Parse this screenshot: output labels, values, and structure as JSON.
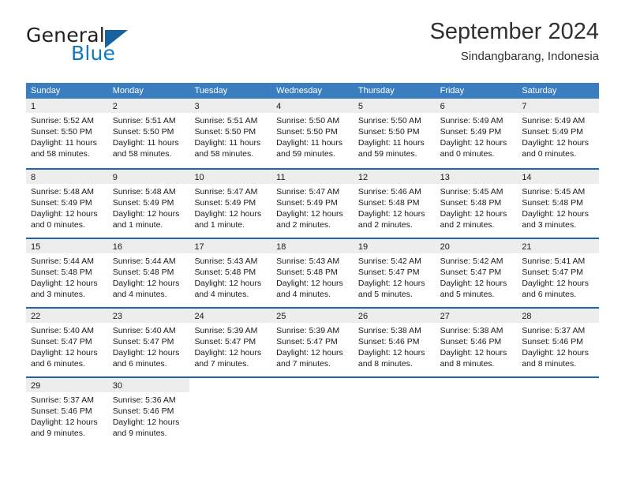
{
  "brand": {
    "name_part1": "General",
    "name_part2": "Blue",
    "flag_icon": "blue-triangle-flag-icon"
  },
  "header": {
    "title": "September 2024",
    "subtitle": "Sindangbarang, Indonesia"
  },
  "colors": {
    "header_blue": "#3a7ebf",
    "row_divider_blue": "#1d64a8",
    "day_band_gray": "#ededed",
    "brand_blue": "#1278be",
    "text": "#1a1a1a"
  },
  "weekdays": [
    "Sunday",
    "Monday",
    "Tuesday",
    "Wednesday",
    "Thursday",
    "Friday",
    "Saturday"
  ],
  "weeks": [
    [
      {
        "day": "1",
        "sunrise": "Sunrise: 5:52 AM",
        "sunset": "Sunset: 5:50 PM",
        "daylight1": "Daylight: 11 hours",
        "daylight2": "and 58 minutes."
      },
      {
        "day": "2",
        "sunrise": "Sunrise: 5:51 AM",
        "sunset": "Sunset: 5:50 PM",
        "daylight1": "Daylight: 11 hours",
        "daylight2": "and 58 minutes."
      },
      {
        "day": "3",
        "sunrise": "Sunrise: 5:51 AM",
        "sunset": "Sunset: 5:50 PM",
        "daylight1": "Daylight: 11 hours",
        "daylight2": "and 58 minutes."
      },
      {
        "day": "4",
        "sunrise": "Sunrise: 5:50 AM",
        "sunset": "Sunset: 5:50 PM",
        "daylight1": "Daylight: 11 hours",
        "daylight2": "and 59 minutes."
      },
      {
        "day": "5",
        "sunrise": "Sunrise: 5:50 AM",
        "sunset": "Sunset: 5:50 PM",
        "daylight1": "Daylight: 11 hours",
        "daylight2": "and 59 minutes."
      },
      {
        "day": "6",
        "sunrise": "Sunrise: 5:49 AM",
        "sunset": "Sunset: 5:49 PM",
        "daylight1": "Daylight: 12 hours",
        "daylight2": "and 0 minutes."
      },
      {
        "day": "7",
        "sunrise": "Sunrise: 5:49 AM",
        "sunset": "Sunset: 5:49 PM",
        "daylight1": "Daylight: 12 hours",
        "daylight2": "and 0 minutes."
      }
    ],
    [
      {
        "day": "8",
        "sunrise": "Sunrise: 5:48 AM",
        "sunset": "Sunset: 5:49 PM",
        "daylight1": "Daylight: 12 hours",
        "daylight2": "and 0 minutes."
      },
      {
        "day": "9",
        "sunrise": "Sunrise: 5:48 AM",
        "sunset": "Sunset: 5:49 PM",
        "daylight1": "Daylight: 12 hours",
        "daylight2": "and 1 minute."
      },
      {
        "day": "10",
        "sunrise": "Sunrise: 5:47 AM",
        "sunset": "Sunset: 5:49 PM",
        "daylight1": "Daylight: 12 hours",
        "daylight2": "and 1 minute."
      },
      {
        "day": "11",
        "sunrise": "Sunrise: 5:47 AM",
        "sunset": "Sunset: 5:49 PM",
        "daylight1": "Daylight: 12 hours",
        "daylight2": "and 2 minutes."
      },
      {
        "day": "12",
        "sunrise": "Sunrise: 5:46 AM",
        "sunset": "Sunset: 5:48 PM",
        "daylight1": "Daylight: 12 hours",
        "daylight2": "and 2 minutes."
      },
      {
        "day": "13",
        "sunrise": "Sunrise: 5:45 AM",
        "sunset": "Sunset: 5:48 PM",
        "daylight1": "Daylight: 12 hours",
        "daylight2": "and 2 minutes."
      },
      {
        "day": "14",
        "sunrise": "Sunrise: 5:45 AM",
        "sunset": "Sunset: 5:48 PM",
        "daylight1": "Daylight: 12 hours",
        "daylight2": "and 3 minutes."
      }
    ],
    [
      {
        "day": "15",
        "sunrise": "Sunrise: 5:44 AM",
        "sunset": "Sunset: 5:48 PM",
        "daylight1": "Daylight: 12 hours",
        "daylight2": "and 3 minutes."
      },
      {
        "day": "16",
        "sunrise": "Sunrise: 5:44 AM",
        "sunset": "Sunset: 5:48 PM",
        "daylight1": "Daylight: 12 hours",
        "daylight2": "and 4 minutes."
      },
      {
        "day": "17",
        "sunrise": "Sunrise: 5:43 AM",
        "sunset": "Sunset: 5:48 PM",
        "daylight1": "Daylight: 12 hours",
        "daylight2": "and 4 minutes."
      },
      {
        "day": "18",
        "sunrise": "Sunrise: 5:43 AM",
        "sunset": "Sunset: 5:48 PM",
        "daylight1": "Daylight: 12 hours",
        "daylight2": "and 4 minutes."
      },
      {
        "day": "19",
        "sunrise": "Sunrise: 5:42 AM",
        "sunset": "Sunset: 5:47 PM",
        "daylight1": "Daylight: 12 hours",
        "daylight2": "and 5 minutes."
      },
      {
        "day": "20",
        "sunrise": "Sunrise: 5:42 AM",
        "sunset": "Sunset: 5:47 PM",
        "daylight1": "Daylight: 12 hours",
        "daylight2": "and 5 minutes."
      },
      {
        "day": "21",
        "sunrise": "Sunrise: 5:41 AM",
        "sunset": "Sunset: 5:47 PM",
        "daylight1": "Daylight: 12 hours",
        "daylight2": "and 6 minutes."
      }
    ],
    [
      {
        "day": "22",
        "sunrise": "Sunrise: 5:40 AM",
        "sunset": "Sunset: 5:47 PM",
        "daylight1": "Daylight: 12 hours",
        "daylight2": "and 6 minutes."
      },
      {
        "day": "23",
        "sunrise": "Sunrise: 5:40 AM",
        "sunset": "Sunset: 5:47 PM",
        "daylight1": "Daylight: 12 hours",
        "daylight2": "and 6 minutes."
      },
      {
        "day": "24",
        "sunrise": "Sunrise: 5:39 AM",
        "sunset": "Sunset: 5:47 PM",
        "daylight1": "Daylight: 12 hours",
        "daylight2": "and 7 minutes."
      },
      {
        "day": "25",
        "sunrise": "Sunrise: 5:39 AM",
        "sunset": "Sunset: 5:47 PM",
        "daylight1": "Daylight: 12 hours",
        "daylight2": "and 7 minutes."
      },
      {
        "day": "26",
        "sunrise": "Sunrise: 5:38 AM",
        "sunset": "Sunset: 5:46 PM",
        "daylight1": "Daylight: 12 hours",
        "daylight2": "and 8 minutes."
      },
      {
        "day": "27",
        "sunrise": "Sunrise: 5:38 AM",
        "sunset": "Sunset: 5:46 PM",
        "daylight1": "Daylight: 12 hours",
        "daylight2": "and 8 minutes."
      },
      {
        "day": "28",
        "sunrise": "Sunrise: 5:37 AM",
        "sunset": "Sunset: 5:46 PM",
        "daylight1": "Daylight: 12 hours",
        "daylight2": "and 8 minutes."
      }
    ],
    [
      {
        "day": "29",
        "sunrise": "Sunrise: 5:37 AM",
        "sunset": "Sunset: 5:46 PM",
        "daylight1": "Daylight: 12 hours",
        "daylight2": "and 9 minutes."
      },
      {
        "day": "30",
        "sunrise": "Sunrise: 5:36 AM",
        "sunset": "Sunset: 5:46 PM",
        "daylight1": "Daylight: 12 hours",
        "daylight2": "and 9 minutes."
      },
      {
        "day": "",
        "sunrise": "",
        "sunset": "",
        "daylight1": "",
        "daylight2": ""
      },
      {
        "day": "",
        "sunrise": "",
        "sunset": "",
        "daylight1": "",
        "daylight2": ""
      },
      {
        "day": "",
        "sunrise": "",
        "sunset": "",
        "daylight1": "",
        "daylight2": ""
      },
      {
        "day": "",
        "sunrise": "",
        "sunset": "",
        "daylight1": "",
        "daylight2": ""
      },
      {
        "day": "",
        "sunrise": "",
        "sunset": "",
        "daylight1": "",
        "daylight2": ""
      }
    ]
  ]
}
